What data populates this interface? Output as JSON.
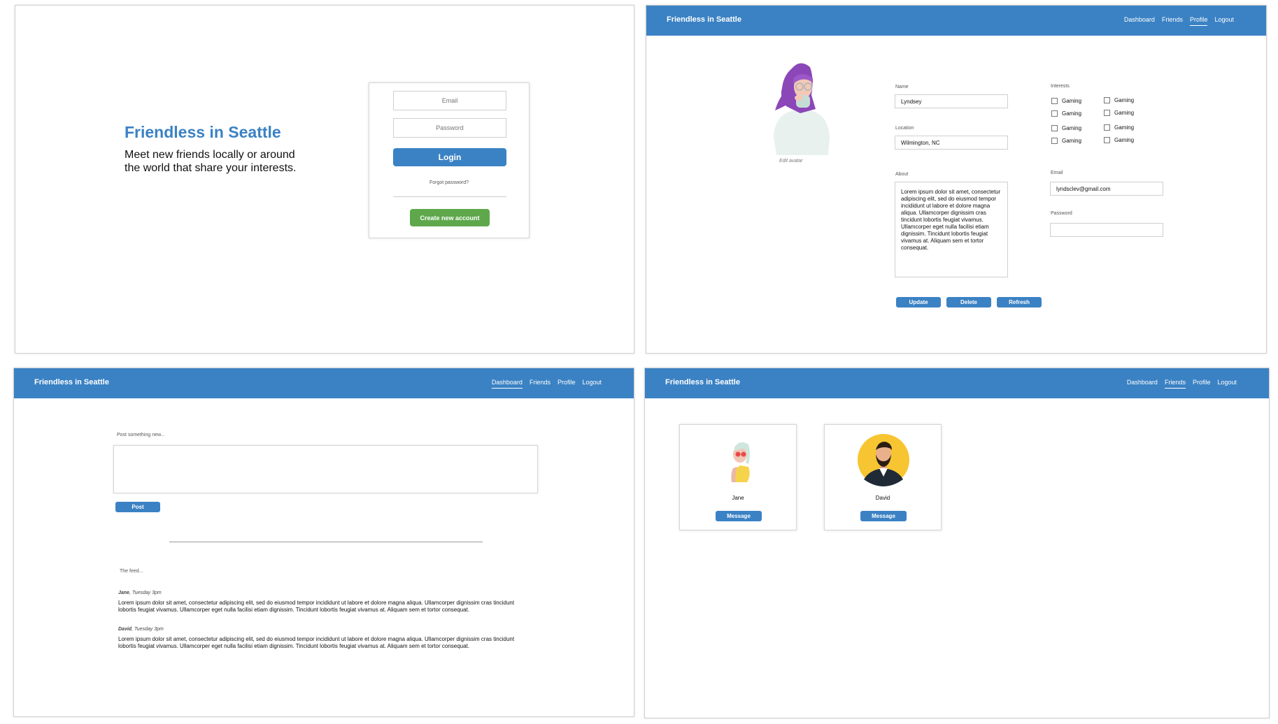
{
  "login": {
    "title": "Friendless in Seattle",
    "subtitle": "Meet new friends locally or around the world that share your interests.",
    "email_placeholder": "Email",
    "password_placeholder": "Password",
    "login_label": "Login",
    "forgot_label": "Forgot password?",
    "create_label": "Create new account",
    "colors": {
      "primary": "#3b82c4",
      "create": "#5ea84b"
    }
  },
  "nav": {
    "brand": "Friendless in Seattle",
    "items": [
      "Dashboard",
      "Friends",
      "Profile",
      "Logout"
    ]
  },
  "profile": {
    "active_tab": "Profile",
    "edit_avatar": "Edit avatar",
    "name_label": "Name",
    "name_value": "Lyndsey",
    "location_label": "Location",
    "location_value": "Wilmington, NC",
    "about_label": "About",
    "about_value": "Lorem ipsum dolor sit amet, consectetur adipiscing elit, sed do eiusmod tempor incididunt ut labore et dolore magna aliqua. Ullamcorper dignissim cras tincidunt lobortis feugiat vivamus. Ullamcorper eget nulla facilisi etiam dignissim. Tincidunt lobortis feugiat vivamus at. Aliquam sem et tortor consequat.",
    "interests_label": "Interests",
    "interests": [
      "Gaming",
      "Gaming",
      "Gaming",
      "Gaming",
      "Gaming",
      "Gaming",
      "Gaming",
      "Gaming"
    ],
    "email_label": "Email",
    "email_value": "lyndsclev@gmail.com",
    "password_label": "Password",
    "password_value": "",
    "update_label": "Update",
    "delete_label": "Delete",
    "refresh_label": "Refresh"
  },
  "dashboard": {
    "active_tab": "Dashboard",
    "post_label": "Post something new...",
    "post_button": "Post",
    "feed_label": "The feed...",
    "feed": [
      {
        "author": "Jane",
        "time": ", Tuesday 3pm",
        "text": "Lorem ipsum dolor sit amet, consectetur adipiscing elit, sed do eiusmod tempor incididunt ut labore et dolore magna aliqua. Ullamcorper dignissim cras tincidunt lobortis feugiat vivamus. Ullamcorper eget nulla facilisi etiam dignissim. Tincidunt lobortis feugiat vivamus at. Aliquam sem et tortor consequat."
      },
      {
        "author": "David",
        "time": ", Tuesday 3pm",
        "text": "Lorem ipsum dolor sit amet, consectetur adipiscing elit, sed do eiusmod tempor incididunt ut labore et dolore magna aliqua. Ullamcorper dignissim cras tincidunt lobortis feugiat vivamus. Ullamcorper eget nulla facilisi etiam dignissim. Tincidunt lobortis feugiat vivamus at. Aliquam sem et tortor consequat."
      }
    ]
  },
  "friends": {
    "active_tab": "Friends",
    "cards": [
      {
        "name": "Jane",
        "button": "Message"
      },
      {
        "name": "David",
        "button": "Message"
      }
    ]
  }
}
